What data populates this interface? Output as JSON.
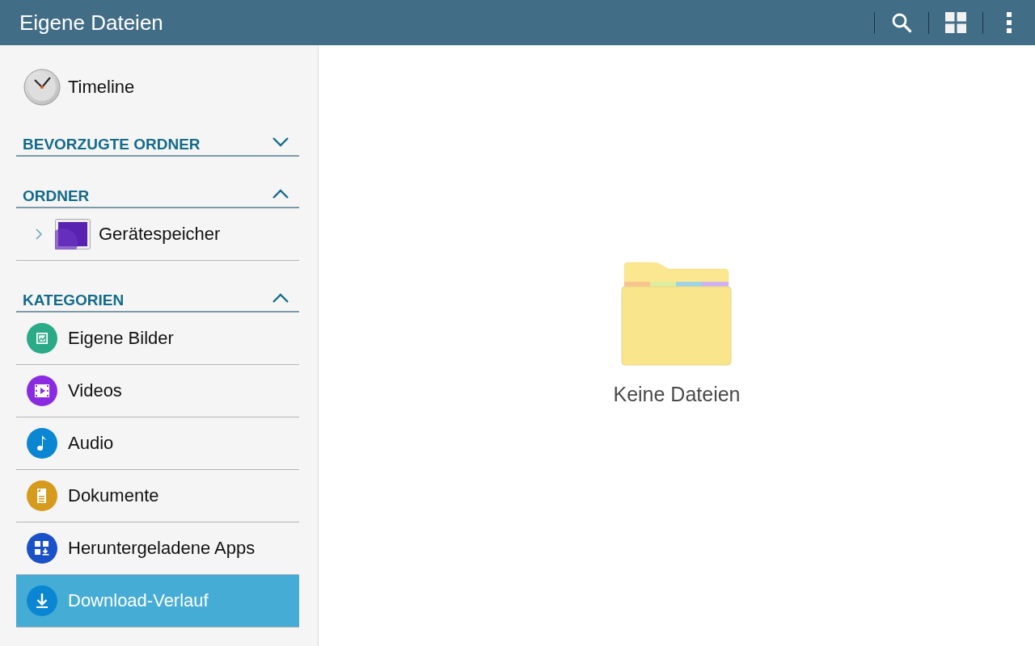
{
  "app_bar": {
    "title": "Eigene Dateien"
  },
  "sidebar": {
    "timeline": {
      "label": "Timeline"
    },
    "sections": [
      {
        "title": "BEVORZUGTE ORDNER",
        "expanded": false
      },
      {
        "title": "ORDNER",
        "expanded": true,
        "items": [
          {
            "kind": "storage",
            "label": "Gerätespeicher",
            "expanded": false,
            "selected": false
          }
        ]
      },
      {
        "title": "KATEGORIEN",
        "expanded": true,
        "items": [
          {
            "kind": "images",
            "label": "Eigene Bilder",
            "color": "#2aaa87",
            "selected": false
          },
          {
            "kind": "videos",
            "label": "Videos",
            "color": "#8a2be2",
            "selected": false
          },
          {
            "kind": "audio",
            "label": "Audio",
            "color": "#0a86d2",
            "selected": false
          },
          {
            "kind": "documents",
            "label": "Dokumente",
            "color": "#d69a1c",
            "selected": false
          },
          {
            "kind": "apps",
            "label": "Heruntergeladene Apps",
            "color": "#1a50c8",
            "selected": false
          },
          {
            "kind": "downloads",
            "label": "Download-Verlauf",
            "color": "#0a86d2",
            "selected": true
          }
        ]
      }
    ]
  },
  "content": {
    "empty_message": "Keine Dateien"
  }
}
